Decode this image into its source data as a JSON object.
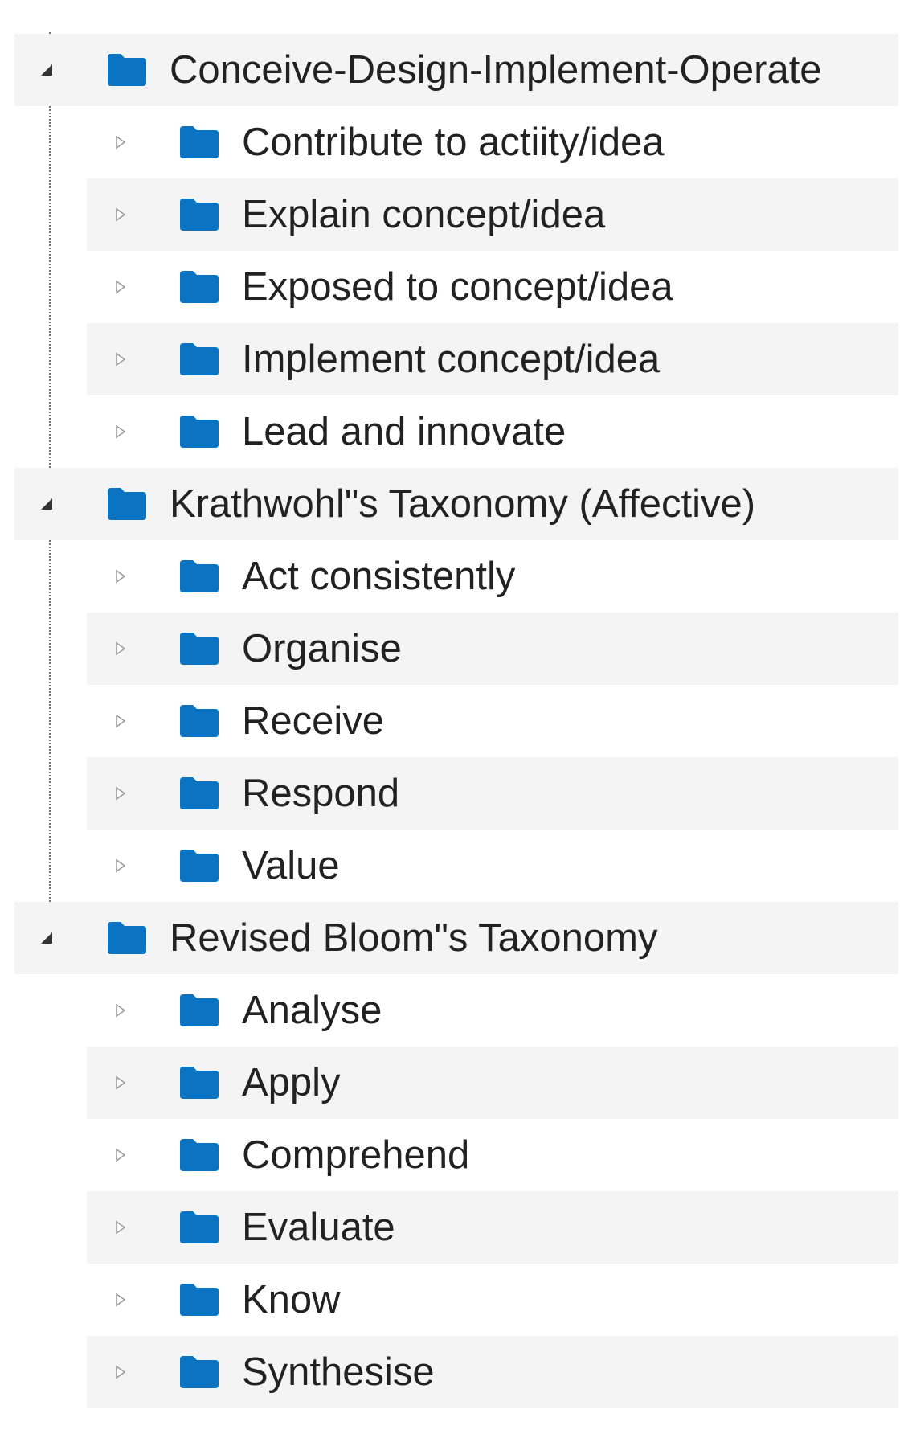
{
  "tree": {
    "icons": {
      "folder": "folder-icon",
      "expanded": "triangle-expanded-icon",
      "collapsed": "triangle-collapsed-icon"
    },
    "colors": {
      "folder": "#0a73c2",
      "text": "#222222",
      "stripe": "#f4f4f4",
      "connector": "#777777"
    },
    "groups": [
      {
        "label": "Conceive-Design-Implement-Operate",
        "expanded": true,
        "children": [
          {
            "label": "Contribute to actiity/idea"
          },
          {
            "label": "Explain concept/idea"
          },
          {
            "label": "Exposed to concept/idea"
          },
          {
            "label": "Implement concept/idea"
          },
          {
            "label": "Lead and innovate"
          }
        ]
      },
      {
        "label": "Krathwohl\"s Taxonomy (Affective)",
        "expanded": true,
        "children": [
          {
            "label": "Act consistently"
          },
          {
            "label": "Organise"
          },
          {
            "label": "Receive"
          },
          {
            "label": "Respond"
          },
          {
            "label": "Value"
          }
        ]
      },
      {
        "label": "Revised Bloom\"s Taxonomy",
        "expanded": true,
        "children": [
          {
            "label": "Analyse"
          },
          {
            "label": "Apply"
          },
          {
            "label": "Comprehend"
          },
          {
            "label": "Evaluate"
          },
          {
            "label": "Know"
          },
          {
            "label": "Synthesise"
          }
        ]
      }
    ]
  }
}
